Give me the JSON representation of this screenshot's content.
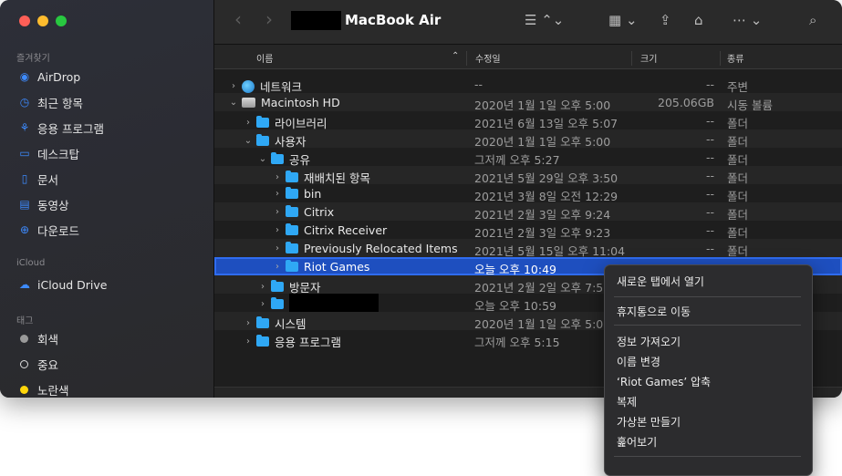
{
  "window": {
    "title": "MacBook Air"
  },
  "toolbar": {
    "back": "‹",
    "forward": "›",
    "list_view": "☰ ⌃⌄",
    "group": "▦ ⌄",
    "share": "⇪",
    "tag": "⌂",
    "more": "⋯ ⌄",
    "search": "⌕"
  },
  "sidebar": {
    "favorites_label": "즐겨찾기",
    "favorites": [
      {
        "label": "AirDrop",
        "icon": "airdrop-icon"
      },
      {
        "label": "최근 항목",
        "icon": "clock-icon"
      },
      {
        "label": "응용 프로그램",
        "icon": "apps-icon"
      },
      {
        "label": "데스크탑",
        "icon": "desktop-icon"
      },
      {
        "label": "문서",
        "icon": "document-icon"
      },
      {
        "label": "동영상",
        "icon": "movie-icon"
      },
      {
        "label": "다운로드",
        "icon": "download-icon"
      }
    ],
    "icloud_label": "iCloud",
    "icloud": [
      {
        "label": "iCloud Drive",
        "icon": "cloud-icon"
      }
    ],
    "tags_label": "태그",
    "tags": [
      {
        "label": "회색",
        "color": "#9a9a9a"
      },
      {
        "label": "중요",
        "color": "#ffffff"
      },
      {
        "label": "노란색",
        "color": "#ffd60a"
      }
    ]
  },
  "columns": {
    "name": "이름",
    "modified": "수정일",
    "size": "크기",
    "kind": "종류"
  },
  "rows": [
    {
      "name": "네트워크",
      "date": "--",
      "size": "--",
      "kind": "주변",
      "indent": 0,
      "expanded": false,
      "icon": "network"
    },
    {
      "name": "Macintosh HD",
      "date": "2020년 1월 1일 오후 5:00",
      "size": "205.06GB",
      "kind": "시동 볼륨",
      "indent": 0,
      "expanded": true,
      "icon": "disk"
    },
    {
      "name": "라이브러리",
      "date": "2021년 6월 13일 오후 5:07",
      "size": "--",
      "kind": "폴더",
      "indent": 1,
      "expanded": false,
      "icon": "folder"
    },
    {
      "name": "사용자",
      "date": "2020년 1월 1일 오후 5:00",
      "size": "--",
      "kind": "폴더",
      "indent": 1,
      "expanded": true,
      "icon": "folder"
    },
    {
      "name": "공유",
      "date": "그저께 오후 5:27",
      "size": "--",
      "kind": "폴더",
      "indent": 2,
      "expanded": true,
      "icon": "folder"
    },
    {
      "name": "재배치된 항목",
      "date": "2021년 5월 29일 오후 3:50",
      "size": "--",
      "kind": "폴더",
      "indent": 3,
      "expanded": false,
      "icon": "folder"
    },
    {
      "name": "bin",
      "date": "2021년 3월 8일 오전 12:29",
      "size": "--",
      "kind": "폴더",
      "indent": 3,
      "expanded": false,
      "icon": "folder"
    },
    {
      "name": "Citrix",
      "date": "2021년 2월 3일 오후 9:24",
      "size": "--",
      "kind": "폴더",
      "indent": 3,
      "expanded": false,
      "icon": "folder"
    },
    {
      "name": "Citrix Receiver",
      "date": "2021년 2월 3일 오후 9:23",
      "size": "--",
      "kind": "폴더",
      "indent": 3,
      "expanded": false,
      "icon": "folder"
    },
    {
      "name": "Previously Relocated Items",
      "date": "2021년 5월 15일 오후 11:04",
      "size": "--",
      "kind": "폴더",
      "indent": 3,
      "expanded": false,
      "icon": "folder"
    },
    {
      "name": "Riot Games",
      "date": "오늘 오후 10:49",
      "size": "",
      "kind": "",
      "indent": 3,
      "expanded": false,
      "icon": "folder",
      "selected": true
    },
    {
      "name": "방문자",
      "date": "2021년 2월 2일 오후 7:58",
      "size": "",
      "kind": "",
      "indent": 2,
      "expanded": false,
      "icon": "folder"
    },
    {
      "name": "",
      "date": "오늘 오후 10:59",
      "size": "",
      "kind": "",
      "indent": 2,
      "expanded": false,
      "icon": "folder",
      "redacted": true
    },
    {
      "name": "시스템",
      "date": "2020년 1월 1일 오후 5:00",
      "size": "",
      "kind": "",
      "indent": 1,
      "expanded": false,
      "icon": "folder"
    },
    {
      "name": "응용 프로그램",
      "date": "그저께 오후 5:15",
      "size": "",
      "kind": "",
      "indent": 1,
      "expanded": false,
      "icon": "folder"
    }
  ],
  "context_menu": {
    "groups": [
      [
        "새로운 탭에서 열기"
      ],
      [
        "휴지통으로 이동"
      ],
      [
        "정보 가져오기",
        "이름 변경",
        "‘Riot Games’ 압축",
        "복제",
        "가상본 만들기",
        "훑어보기"
      ]
    ]
  }
}
